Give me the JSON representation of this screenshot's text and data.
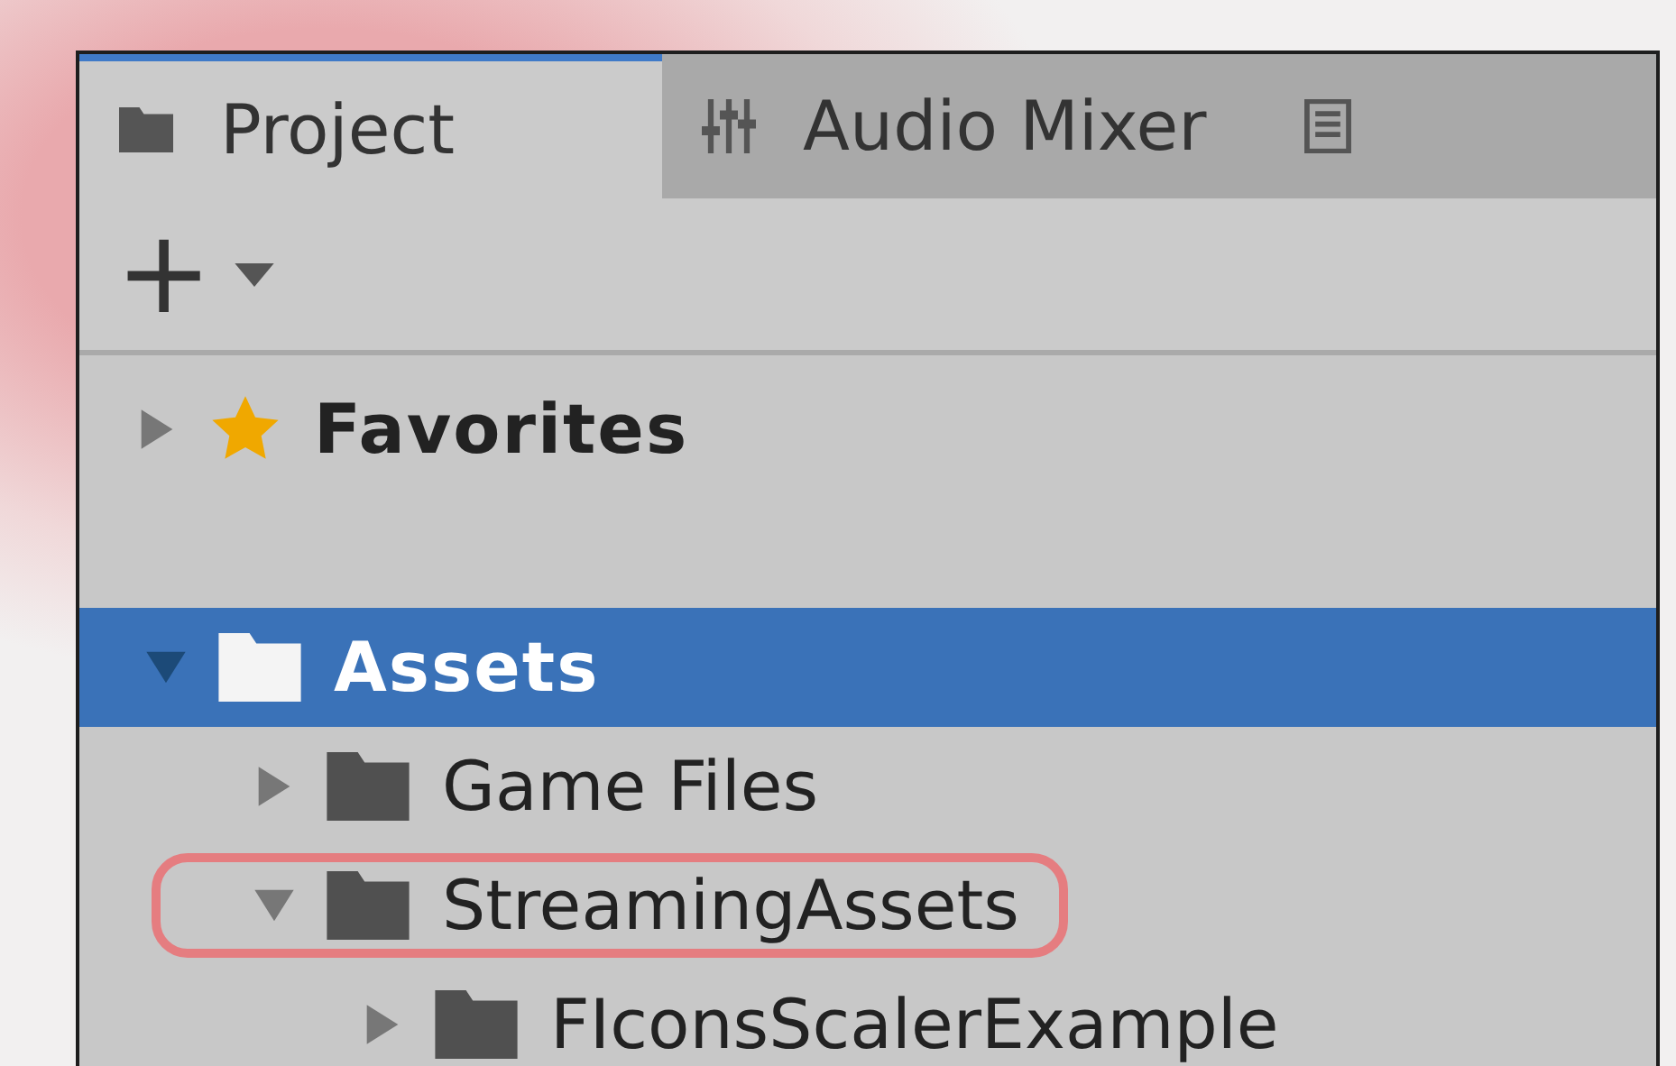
{
  "tabs": [
    {
      "kind": "folder",
      "label": "Project",
      "selected": true
    },
    {
      "kind": "mixer",
      "label": "Audio Mixer",
      "selected": false
    },
    {
      "kind": "list",
      "selected": false
    }
  ],
  "toolbar": {
    "add_button": "+"
  },
  "favorites": {
    "label": "Favorites",
    "expanded": false
  },
  "tree": [
    {
      "label": "Assets",
      "expanded": true,
      "selected": true,
      "annotated": false,
      "children": [
        {
          "label": "Game Files",
          "expanded": false,
          "selected": false,
          "annotated": false
        },
        {
          "label": "StreamingAssets",
          "expanded": true,
          "selected": false,
          "annotated": true,
          "children": [
            {
              "label": "FIconsScalerExample",
              "expanded": false,
              "selected": false,
              "annotated": false
            }
          ]
        }
      ]
    }
  ]
}
